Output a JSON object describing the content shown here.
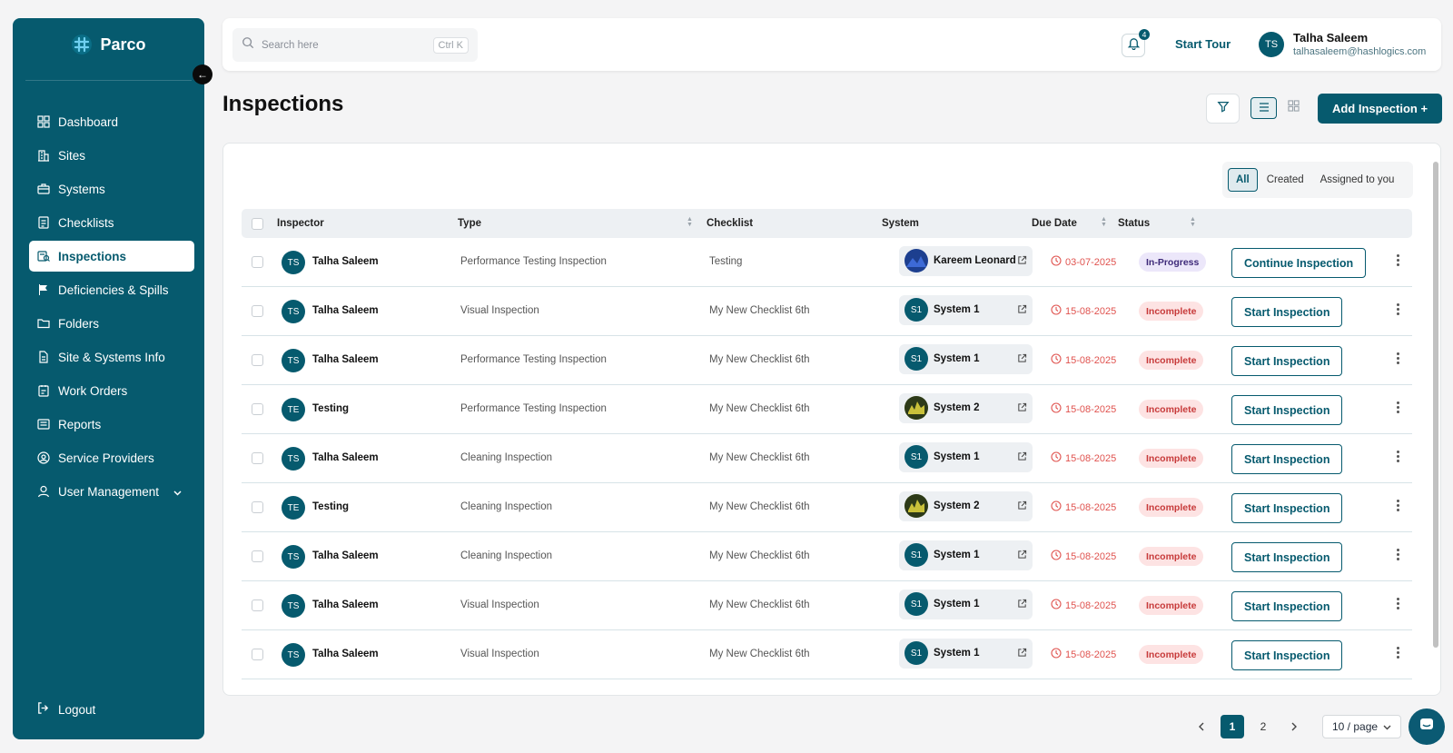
{
  "app": {
    "brand": "Parco"
  },
  "colors": {
    "primary": "#065a6e",
    "danger": "#e0534f",
    "progress_bg": "#ece7fa"
  },
  "sidebar": {
    "items": [
      {
        "label": "Dashboard",
        "icon": "dashboard-icon"
      },
      {
        "label": "Sites",
        "icon": "building-icon"
      },
      {
        "label": "Systems",
        "icon": "briefcase-icon"
      },
      {
        "label": "Checklists",
        "icon": "checklist-icon"
      },
      {
        "label": "Inspections",
        "icon": "inspection-icon",
        "active": true
      },
      {
        "label": "Deficiencies & Spills",
        "icon": "flag-icon"
      },
      {
        "label": "Folders",
        "icon": "folder-icon"
      },
      {
        "label": "Site & Systems Info",
        "icon": "document-icon"
      },
      {
        "label": "Work Orders",
        "icon": "work-order-icon"
      },
      {
        "label": "Reports",
        "icon": "report-icon"
      },
      {
        "label": "Service Providers",
        "icon": "provider-icon"
      },
      {
        "label": "User Management",
        "icon": "user-icon",
        "has_submenu": true
      }
    ],
    "logout_label": "Logout"
  },
  "topbar": {
    "search_placeholder": "Search here",
    "search_shortcut": "Ctrl K",
    "notification_count": "4",
    "start_tour_label": "Start Tour",
    "user": {
      "initials": "TS",
      "name": "Talha Saleem",
      "email": "talhasaleem@hashlogics.com"
    }
  },
  "page": {
    "title": "Inspections",
    "add_button_label": "Add Inspection +"
  },
  "tabs": [
    {
      "label": "All",
      "active": true
    },
    {
      "label": "Created"
    },
    {
      "label": "Assigned to you"
    }
  ],
  "table": {
    "columns": [
      "Inspector",
      "Type",
      "Checklist",
      "System",
      "Due Date",
      "Status"
    ],
    "rows": [
      {
        "initials": "TS",
        "inspector": "Talha Saleem",
        "type": "Performance Testing Inspection",
        "checklist": "Testing",
        "system_initials": "",
        "system_avatar": "blue",
        "system": "Kareem Leonard",
        "due": "03-07-2025",
        "status": "In-Progress",
        "status_kind": "prog",
        "action": "Continue Inspection"
      },
      {
        "initials": "TS",
        "inspector": "Talha Saleem",
        "type": "Visual Inspection",
        "checklist": "My New Checklist 6th",
        "system_initials": "S1",
        "system_avatar": "teal",
        "system": "System 1",
        "due": "15-08-2025",
        "status": "Incomplete",
        "status_kind": "inc",
        "action": "Start Inspection"
      },
      {
        "initials": "TS",
        "inspector": "Talha Saleem",
        "type": "Performance Testing Inspection",
        "checklist": "My New Checklist 6th",
        "system_initials": "S1",
        "system_avatar": "teal",
        "system": "System 1",
        "due": "15-08-2025",
        "status": "Incomplete",
        "status_kind": "inc",
        "action": "Start Inspection"
      },
      {
        "initials": "TE",
        "inspector": "Testing",
        "type": "Performance Testing Inspection",
        "checklist": "My New Checklist 6th",
        "system_initials": "",
        "system_avatar": "photo",
        "system": "System 2",
        "due": "15-08-2025",
        "status": "Incomplete",
        "status_kind": "inc",
        "action": "Start Inspection"
      },
      {
        "initials": "TS",
        "inspector": "Talha Saleem",
        "type": "Cleaning Inspection",
        "checklist": "My New Checklist 6th",
        "system_initials": "S1",
        "system_avatar": "teal",
        "system": "System 1",
        "due": "15-08-2025",
        "status": "Incomplete",
        "status_kind": "inc",
        "action": "Start Inspection"
      },
      {
        "initials": "TE",
        "inspector": "Testing",
        "type": "Cleaning Inspection",
        "checklist": "My New Checklist 6th",
        "system_initials": "",
        "system_avatar": "photo",
        "system": "System 2",
        "due": "15-08-2025",
        "status": "Incomplete",
        "status_kind": "inc",
        "action": "Start Inspection"
      },
      {
        "initials": "TS",
        "inspector": "Talha Saleem",
        "type": "Cleaning Inspection",
        "checklist": "My New Checklist 6th",
        "system_initials": "S1",
        "system_avatar": "teal",
        "system": "System 1",
        "due": "15-08-2025",
        "status": "Incomplete",
        "status_kind": "inc",
        "action": "Start Inspection"
      },
      {
        "initials": "TS",
        "inspector": "Talha Saleem",
        "type": "Visual Inspection",
        "checklist": "My New Checklist 6th",
        "system_initials": "S1",
        "system_avatar": "teal",
        "system": "System 1",
        "due": "15-08-2025",
        "status": "Incomplete",
        "status_kind": "inc",
        "action": "Start Inspection"
      },
      {
        "initials": "TS",
        "inspector": "Talha Saleem",
        "type": "Visual Inspection",
        "checklist": "My New Checklist 6th",
        "system_initials": "S1",
        "system_avatar": "teal",
        "system": "System 1",
        "due": "15-08-2025",
        "status": "Incomplete",
        "status_kind": "inc",
        "action": "Start Inspection"
      }
    ]
  },
  "pagination": {
    "pages": [
      "1",
      "2"
    ],
    "current": "1",
    "per_page": "10 / page"
  }
}
